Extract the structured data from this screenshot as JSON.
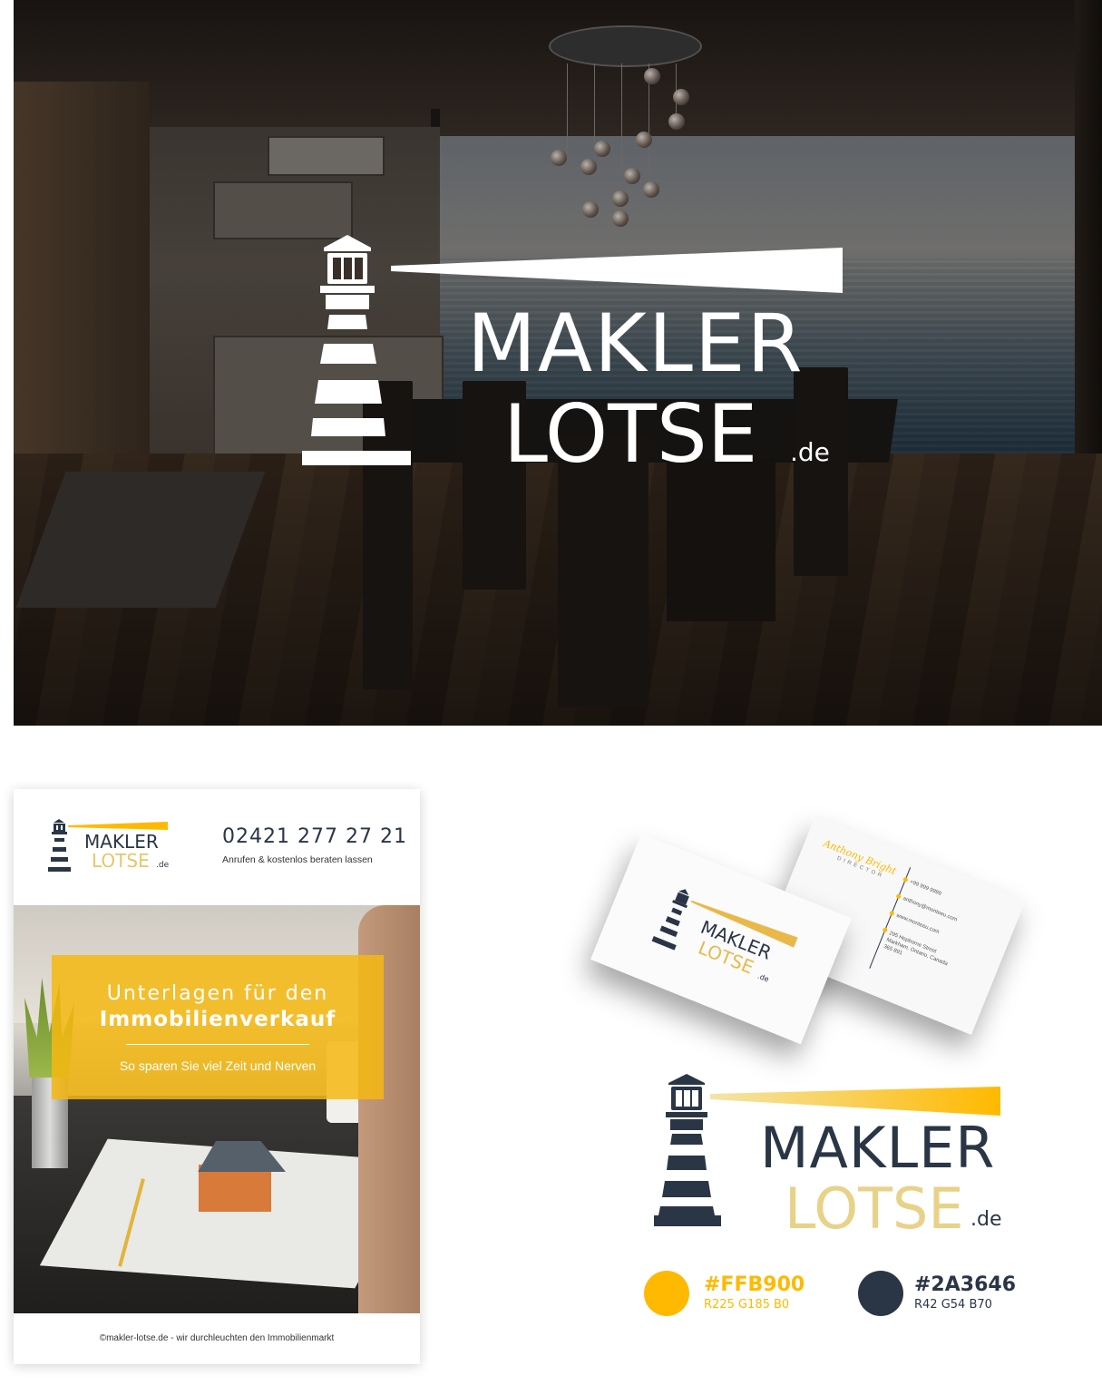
{
  "brand": {
    "line1": "MAKLER",
    "line2": "LOTSE",
    "suffix": ".de"
  },
  "flyer": {
    "phone": "02421 277 27 21",
    "phone_caption": "Anrufen & kostenlos beraten lassen",
    "headline_light": "Unterlagen für den",
    "headline_bold": "Immobilienverkauf",
    "subline": "So sparen Sie viel Zeit und Nerven",
    "footer": "©makler-lotse.de - wir durchleuchten den Immobilienmarkt"
  },
  "business_card": {
    "name": "Anthony Bright",
    "title": "DIRECTOR",
    "phone": "+99 999 9999",
    "email": "anthony@monteeu.com",
    "web": "www.monteeu.com",
    "address": "295 Hepborne Street Markham, Ontario, Canada 365 891"
  },
  "palette": [
    {
      "hex": "#FFB900",
      "rgb": "R225 G185 B0",
      "color": "#FFB900"
    },
    {
      "hex": "#2A3646",
      "rgb": "R42 G54 B70",
      "color": "#2A3646"
    }
  ],
  "colors": {
    "accent": "#FFB900",
    "dark": "#2A3646",
    "accent_light": "#E8D28A"
  }
}
